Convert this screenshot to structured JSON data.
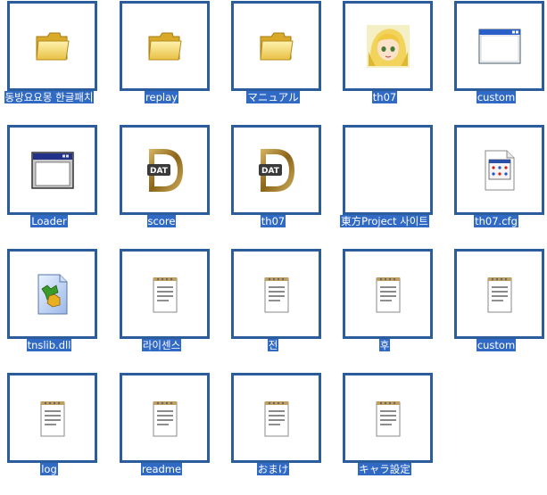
{
  "colors": {
    "thumbnail_border": "#2b5d9c",
    "selection_highlight": "#316ac5",
    "label_text": "#ffffff"
  },
  "items": [
    {
      "label": "동방요요몽 한글패치",
      "icon": "folder-icon"
    },
    {
      "label": "replay",
      "icon": "folder-icon"
    },
    {
      "label": "マニュアル",
      "icon": "folder-icon"
    },
    {
      "label": "th07",
      "icon": "character-portrait-icon"
    },
    {
      "label": "custom",
      "icon": "window-app-icon"
    },
    {
      "label": "Loader",
      "icon": "window-app-icon"
    },
    {
      "label": "score",
      "icon": "dat-file-icon"
    },
    {
      "label": "th07",
      "icon": "dat-file-icon"
    },
    {
      "label": "東方Project 사이트",
      "icon": "blank-shortcut"
    },
    {
      "label": "th07.cfg",
      "icon": "cfg-file-icon"
    },
    {
      "label": "tnslib.dll",
      "icon": "dll-file-icon"
    },
    {
      "label": "라이센스",
      "icon": "notepad-text-icon"
    },
    {
      "label": "전",
      "icon": "notepad-text-icon"
    },
    {
      "label": "후",
      "icon": "notepad-text-icon"
    },
    {
      "label": "custom",
      "icon": "notepad-text-icon"
    },
    {
      "label": "log",
      "icon": "notepad-text-icon"
    },
    {
      "label": "readme",
      "icon": "notepad-text-icon"
    },
    {
      "label": "おまけ",
      "icon": "notepad-text-icon"
    },
    {
      "label": "キャラ設定",
      "icon": "notepad-text-icon"
    }
  ]
}
